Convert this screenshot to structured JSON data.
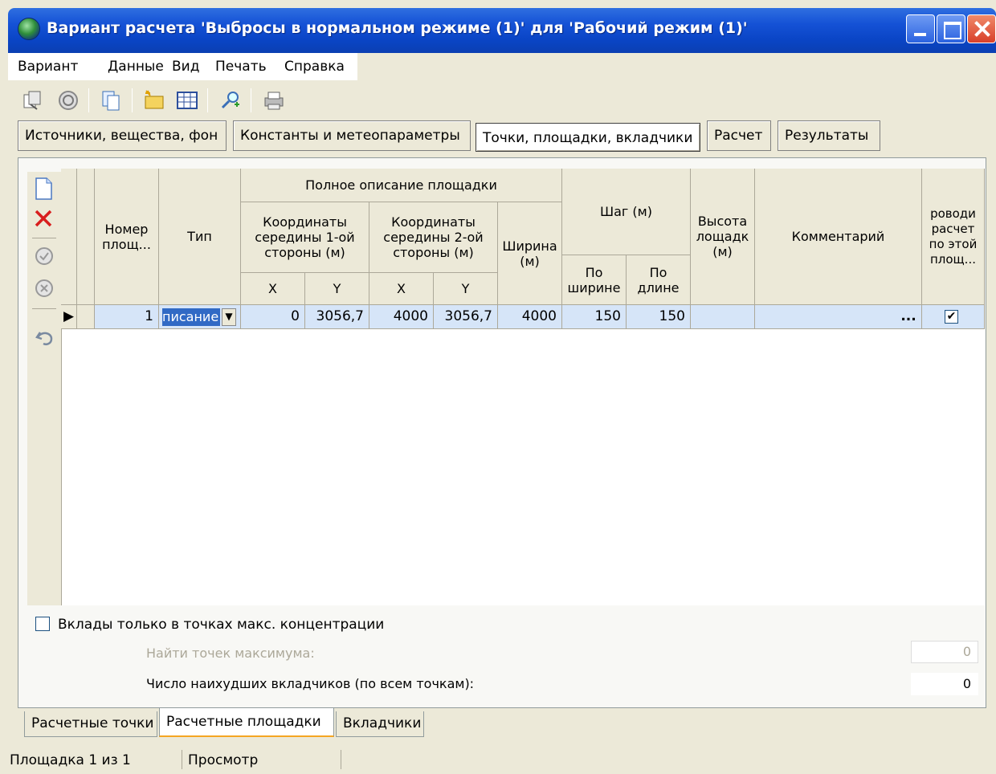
{
  "window": {
    "title": "Вариант расчета 'Выбросы в нормальном режиме (1)' для  'Рабочий режим (1)'"
  },
  "menu": {
    "items": [
      "Вариант",
      "Данные",
      "Вид",
      "Печать",
      "Справка"
    ]
  },
  "toolbar": {
    "icons": [
      "copy-doc-icon",
      "refresh-icon",
      "duplicate-icon",
      "new-folder-icon",
      "grid-icon",
      "search-icon",
      "print-icon"
    ]
  },
  "page_tabs": {
    "items": [
      "Источники, вещества, фон",
      "Константы и метеопараметры",
      "Точки, площадки, вкладчики",
      "Расчет",
      "Результаты"
    ],
    "active": 2
  },
  "grid": {
    "headers": {
      "num": "Номер\nплощ...",
      "type": "Тип",
      "full_desc": "Полное описание площадки",
      "coord1": "Координаты\nсередины 1-ой\nстороны (м)",
      "coord2": "Координаты\nсередины 2-ой\nстороны (м)",
      "x1": "X",
      "y1": "Y",
      "x2": "X",
      "y2": "Y",
      "width": "Ширина\n(м)",
      "step": "Шаг (м)",
      "step_w": "По\nширине",
      "step_l": "По\nдлине",
      "height": "Высота\nлощадк\n(м)",
      "comment": "Комментарий",
      "calc": "роводи\nрасчет\nпо этой\nплощ..."
    },
    "rows": [
      {
        "num": "1",
        "type": "писание",
        "x1": "0",
        "y1": "3056,7",
        "x2": "4000",
        "y2": "3056,7",
        "width": "4000",
        "step_w": "150",
        "step_l": "150",
        "height": "",
        "comment": "",
        "comment_btn": "...",
        "calc_checked": true
      }
    ]
  },
  "options": {
    "contrib_only_max": "Вклады только в точках макс. концентрации",
    "find_max_label": "Найти точек максимума:",
    "find_max_value": "0",
    "worst_label": "Число наихудших вкладчиков (по всем точкам):",
    "worst_value": "0"
  },
  "bottom_tabs": {
    "items": [
      "Расчетные точки",
      "Расчетные площадки",
      "Вкладчики"
    ],
    "active": 1
  },
  "status": {
    "left": "Площадка 1 из 1",
    "mode": "Просмотр"
  },
  "colors": {
    "title_bar": "#1552d6",
    "selected_row": "#d6e5f8",
    "active_tab_accent": "#f5a623"
  }
}
